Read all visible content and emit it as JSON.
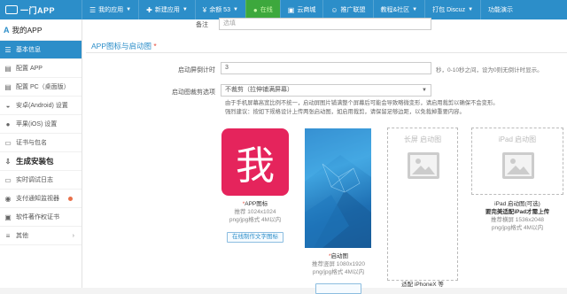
{
  "app": {
    "brand": "一门APP"
  },
  "topnav": [
    {
      "label": "我的应用",
      "icon": "list-icon",
      "caret": true
    },
    {
      "label": "新建应用",
      "icon": "plus-icon",
      "caret": true
    },
    {
      "label": "余额 53",
      "icon": "coin-icon",
      "caret": true
    },
    {
      "label": "在线",
      "icon": "online-dot-icon",
      "caret": false
    },
    {
      "label": "云商城",
      "icon": "shop-icon",
      "caret": false
    },
    {
      "label": "推广联盟",
      "icon": "union-icon",
      "caret": false
    },
    {
      "label": "教程&社区",
      "icon": "",
      "caret": true
    },
    {
      "label": "打包 Discuz",
      "icon": "",
      "caret": true
    },
    {
      "label": "功能演示",
      "icon": "",
      "caret": false
    }
  ],
  "sidebar": {
    "title": "我的APP",
    "items": [
      {
        "label": "基本信息",
        "icon": "list-icon",
        "active": true
      },
      {
        "label": "配置 APP",
        "icon": "config-icon"
      },
      {
        "label": "配置 PC（桌面版）",
        "icon": "config-icon"
      },
      {
        "label": "安卓(Android) 设置",
        "icon": "android-icon"
      },
      {
        "label": "苹果(iOS) 设置",
        "icon": "apple-icon"
      },
      {
        "label": "证书与包名",
        "icon": "certificate-icon"
      },
      {
        "label": "生成安装包",
        "icon": "build-icon",
        "big": true
      },
      {
        "label": "实时调试日志",
        "icon": "log-icon"
      },
      {
        "label": "支付通知监视器",
        "icon": "monitor-icon",
        "dot": true
      },
      {
        "label": "软件著作权证书",
        "icon": "copyright-icon"
      },
      {
        "label": "其他",
        "icon": "more-icon",
        "arrow": true
      }
    ]
  },
  "form": {
    "remark_label": "备注",
    "remark_placeholder": "选填",
    "section_title": "APP图标与启动图",
    "required_mark": "*",
    "countdown_label": "启动屏倒计时",
    "countdown_value": "3",
    "countdown_help": "秒，0-10秒之间，设为0则无倒计时显示。",
    "crop_label": "启动图裁剪选项",
    "crop_value": "不裁剪（拉伸铺满屏幕）",
    "crop_desc_1": "由于手机屏幕高宽比例不统一，启动屏图片铺满整个屏幕后可能会导致略微变形，请启用裁剪以确保不会变形。",
    "crop_desc_2": "强烈建议：按如下规格设计上传两张启动图，如启用裁剪，请保留足够边距，以免裁掉重要内容。"
  },
  "cards": {
    "icon": {
      "glyph": "我",
      "title": "APP图标",
      "spec": "推荐 1024x1024",
      "format": "png/jpg格式 4M以内",
      "button": "在线制作文字图标"
    },
    "splash": {
      "title": "启动图",
      "spec": "推荐竖屏 1080x1920",
      "format": "png/jpg格式 4M以内"
    },
    "long": {
      "placeholder": "长屏 启动图",
      "caption": "适配 iPhoneX 等"
    },
    "ipad": {
      "placeholder": "iPad 启动图",
      "title": "iPad 启动图(可选)",
      "note": "要完美适配iPad才需上传",
      "spec": "推荐横屏 1536x2048",
      "format": "png/jpg格式 4M以内"
    }
  },
  "colors": {
    "primary": "#2c8ec9",
    "online": "#3da83d",
    "required": "#e64b3b",
    "icon_bg": "#e5245c"
  }
}
